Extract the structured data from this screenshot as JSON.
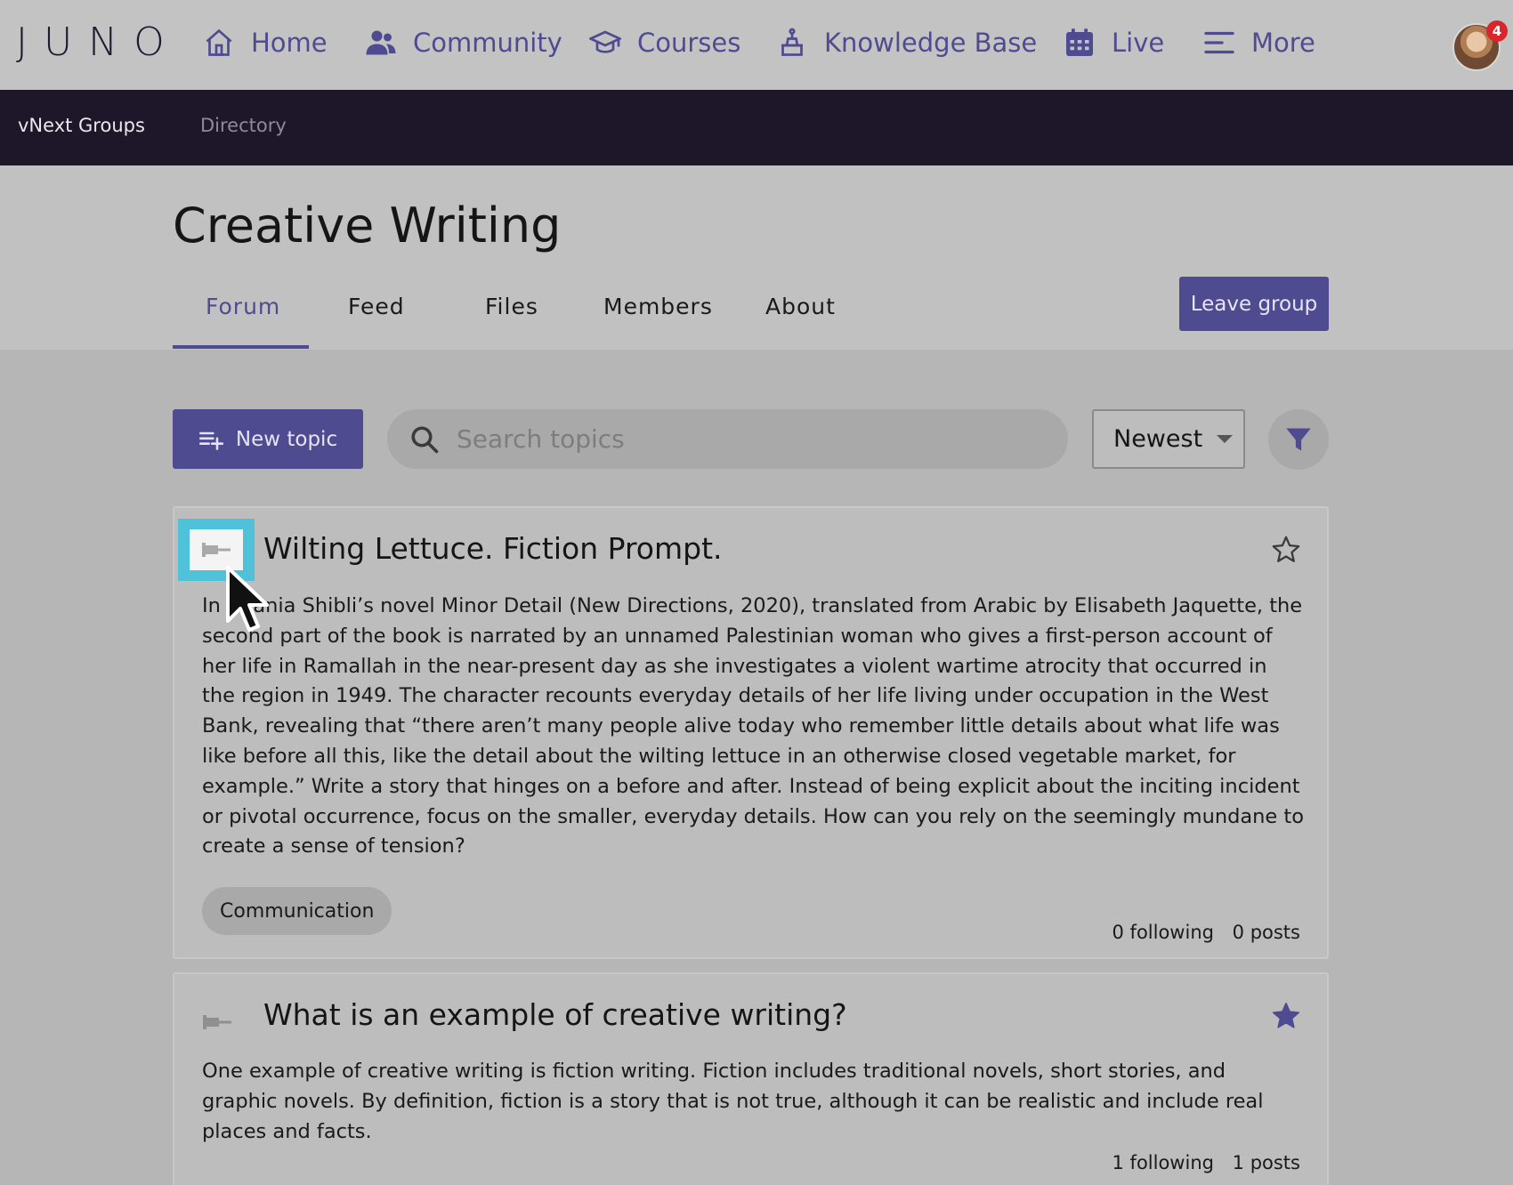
{
  "app": {
    "logo": "JUNO",
    "nav": [
      {
        "label": "Home",
        "icon": "home-icon"
      },
      {
        "label": "Community",
        "icon": "people-icon"
      },
      {
        "label": "Courses",
        "icon": "graduation-cap-icon"
      },
      {
        "label": "Knowledge Base",
        "icon": "lamp-icon"
      },
      {
        "label": "Live",
        "icon": "calendar-icon"
      },
      {
        "label": "More",
        "icon": "menu-icon"
      }
    ],
    "notification_count": "4",
    "accent_color": "#4f4b90"
  },
  "subnav": {
    "groups_label": "vNext Groups",
    "directory_label": "Directory"
  },
  "group": {
    "title": "Creative Writing",
    "tabs": [
      "Forum",
      "Feed",
      "Files",
      "Members",
      "About"
    ],
    "active_tab": "Forum",
    "leave_label": "Leave group"
  },
  "toolbar": {
    "new_topic_label": "New topic",
    "search_placeholder": "Search topics",
    "sort_value": "Newest"
  },
  "topics": [
    {
      "title": "Wilting Lettuce. Fiction Prompt.",
      "body": "In Adania Shibli’s novel Minor Detail (New Directions, 2020), translated from Arabic by Elisabeth Jaquette, the second part of the book is narrated by an unnamed Palestinian woman who gives a first-person account of her life in Ramallah in the near-present day as she investigates a violent wartime atrocity that occurred in the region in 1949. The character recounts everyday details of her life living under occupation in the West Bank, revealing that “there aren’t many people alive today who remember little details about what life was like before all this, like the detail about the wilting lettuce in an otherwise closed vegetable market, for example.” Write a story that hinges on a before and after. Instead of being explicit about the inciting incident or pivotal occurrence, focus on the smaller, everyday details. How can you rely on the seemingly mundane to create a sense of tension?",
      "tag": "Communication",
      "following": "0 following",
      "posts": "0 posts",
      "starred": false
    },
    {
      "title": "What is an example of creative writing?",
      "body": "One example of creative writing is fiction writing. Fiction includes traditional novels, short stories, and graphic novels. By definition, fiction is a story that is not true, although it can be realistic and include real places and facts.",
      "following": "1 following",
      "posts": "1 posts",
      "starred": true
    }
  ]
}
